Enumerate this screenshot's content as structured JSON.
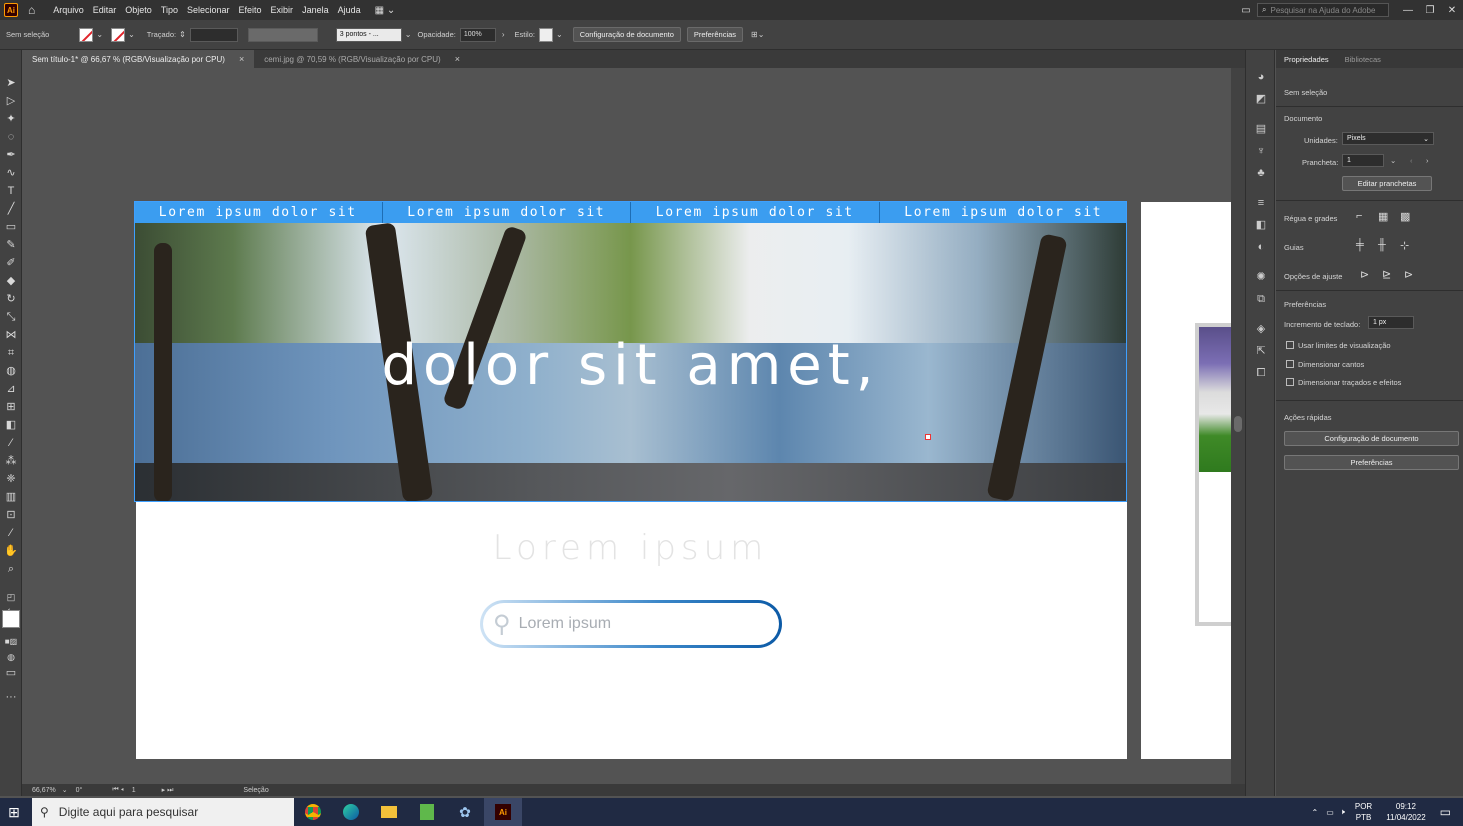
{
  "app": {
    "logo": "Ai",
    "menu": [
      "Arquivo",
      "Editar",
      "Objeto",
      "Tipo",
      "Selecionar",
      "Efeito",
      "Exibir",
      "Janela",
      "Ajuda"
    ],
    "help_search_placeholder": "Pesquisar na Ajuda do Adobe"
  },
  "control": {
    "selection": "Sem seleção",
    "stroke_label": "Traçado:",
    "brush": "3 pontos - ...",
    "opacity_label": "Opacidade:",
    "opacity_value": "100%",
    "style_label": "Estilo:",
    "doc_setup": "Configuração de documento",
    "preferences": "Preferências"
  },
  "tabs": [
    {
      "label": "Sem título-1* @ 66,67 % (RGB/Visualização por CPU)",
      "close": "×"
    },
    {
      "label": "cemi.jpg @ 70,59 % (RGB/Visualização por CPU)",
      "close": "×"
    }
  ],
  "artboard": {
    "nav": [
      "Lorem  ipsum  dolor  sit",
      "Lorem  ipsum  dolor  sit",
      "Lorem  ipsum  dolor  sit",
      "Lorem  ipsum  dolor  sit"
    ],
    "hero_title": "dolor  sit  amet,",
    "subtitle": "Lorem  ipsum",
    "search_placeholder": "Lorem ipsum",
    "accent": "#3b9df0"
  },
  "status": {
    "zoom": "66,67%",
    "rotation": "0°",
    "artboard_num": "1",
    "tool": "Seleção"
  },
  "properties": {
    "tab_active": "Propriedades",
    "tab_other": "Bibliotecas",
    "no_selection": "Sem seleção",
    "document": "Documento",
    "units_label": "Unidades:",
    "units_value": "Pixels",
    "artboard_label": "Prancheta:",
    "artboard_value": "1",
    "edit_artboards": "Editar pranchetas",
    "rulers": "Régua e grades",
    "guides": "Guias",
    "snap": "Opções de ajuste",
    "prefs": "Preferências",
    "key_inc_label": "Incremento de teclado:",
    "key_inc_value": "1 px",
    "cb1": "Usar limites de visualização",
    "cb2": "Dimensionar cantos",
    "cb3": "Dimensionar traçados e efeitos",
    "quick": "Ações rápidas",
    "btn_doc": "Configuração de documento",
    "btn_prefs": "Preferências"
  },
  "taskbar": {
    "search": "Digite aqui para pesquisar",
    "lang1": "POR",
    "lang2": "PTB",
    "time": "09:12",
    "date": "11/04/2022"
  }
}
